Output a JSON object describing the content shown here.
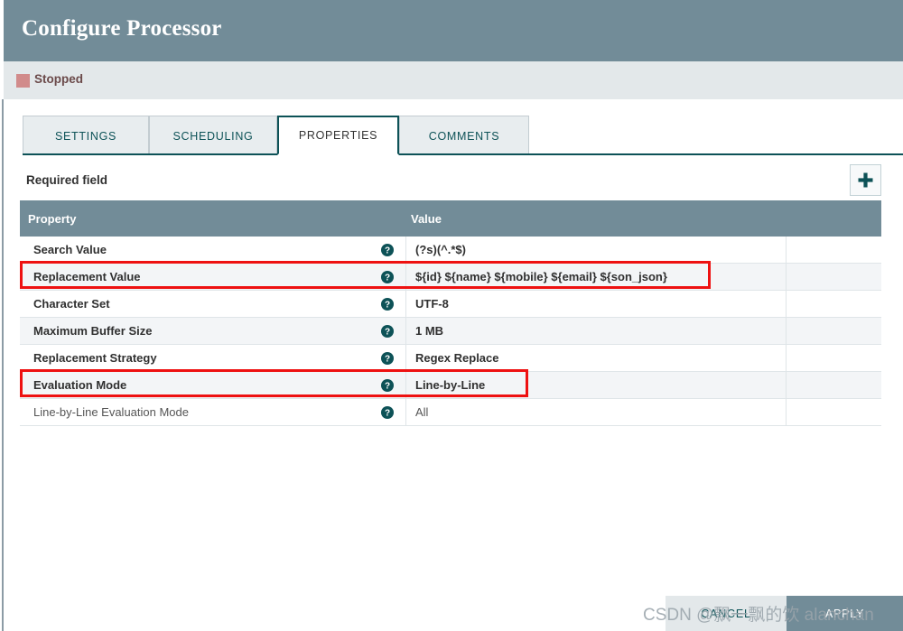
{
  "window": {
    "title": "Configure Processor"
  },
  "status": {
    "label": "Stopped",
    "color": "#d18b8b"
  },
  "tabs": [
    {
      "label": "SETTINGS",
      "active": false
    },
    {
      "label": "SCHEDULING",
      "active": false
    },
    {
      "label": "PROPERTIES",
      "active": true
    },
    {
      "label": "COMMENTS",
      "active": false
    }
  ],
  "toolbar": {
    "required_field_label": "Required field",
    "add_button_icon": "plus-icon",
    "add_button_label": "+"
  },
  "table": {
    "columns": [
      "Property",
      "Value"
    ],
    "help_icon": "help-circle-icon",
    "rows": [
      {
        "property": "Search Value",
        "value": "(?s)(^.*$)",
        "optional": false,
        "highlighted": false
      },
      {
        "property": "Replacement Value",
        "value": "${id} ${name} ${mobile} ${email} ${son_json}",
        "optional": false,
        "highlighted": true
      },
      {
        "property": "Character Set",
        "value": "UTF-8",
        "optional": false,
        "highlighted": false
      },
      {
        "property": "Maximum Buffer Size",
        "value": "1 MB",
        "optional": false,
        "highlighted": false
      },
      {
        "property": "Replacement Strategy",
        "value": "Regex Replace",
        "optional": false,
        "highlighted": false
      },
      {
        "property": "Evaluation Mode",
        "value": "Line-by-Line",
        "optional": false,
        "highlighted": true
      },
      {
        "property": "Line-by-Line Evaluation Mode",
        "value": "All",
        "optional": true,
        "highlighted": false
      }
    ]
  },
  "footer": {
    "cancel_label": "CANCEL",
    "apply_label": "APPLY"
  },
  "watermark": {
    "text": "CSDN @飘一飘的饮 alanchan"
  },
  "colors": {
    "header_bg": "#728c98",
    "accent_teal": "#0d5257",
    "highlight_red": "#ee1111",
    "status_red": "#d18b8b",
    "row_alt": "#f3f5f7"
  }
}
